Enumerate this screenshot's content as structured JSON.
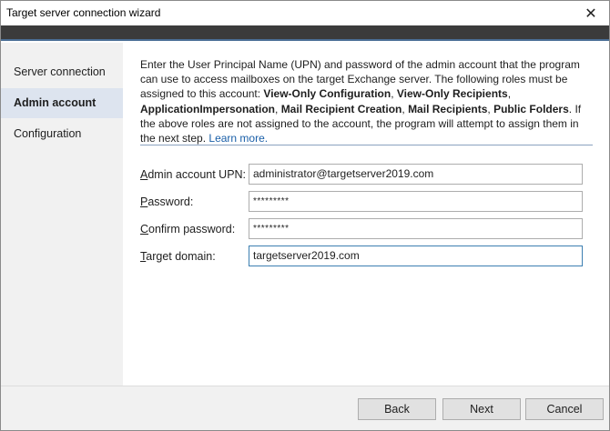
{
  "window": {
    "title": "Target server connection wizard",
    "close_glyph": "✕",
    "colors": {
      "banner": "#3b3b3b",
      "accent": "#4a6e95",
      "sidebar_bg": "#f1f1f1",
      "active_item_bg": "#dde4ef",
      "link": "#1a5fa8"
    }
  },
  "sidebar": {
    "items": [
      {
        "label": "Server connection",
        "active": false
      },
      {
        "label": "Admin account",
        "active": true
      },
      {
        "label": "Configuration",
        "active": false
      }
    ]
  },
  "description": {
    "intro": "Enter the User Principal Name (UPN) and password of the admin account that the program can use to access mailboxes on the target Exchange server. The following roles must be assigned to this account: ",
    "roles": [
      "View-Only Configuration",
      "View-Only Recipients",
      "ApplicationImpersonation",
      "Mail Recipient Creation",
      "Mail Recipients",
      "Public Folders"
    ],
    "separator": ", ",
    "period": ".",
    "outro": " If the above roles are not assigned to the account, the program will attempt to assign them in the next step. ",
    "link": "Learn more."
  },
  "form": {
    "fields": [
      {
        "label_accel": "A",
        "label_rest": "dmin account UPN:",
        "value": "administrator@targetserver2019.com"
      },
      {
        "label_accel": "P",
        "label_rest": "assword:",
        "value": "*********"
      },
      {
        "label_accel": "C",
        "label_rest": "onfirm password:",
        "value": "*********"
      },
      {
        "label_accel": "T",
        "label_rest": "arget domain:",
        "value": "targetserver2019.com"
      }
    ]
  },
  "buttons": {
    "back": "Back",
    "next": "Next",
    "cancel": "Cancel"
  }
}
